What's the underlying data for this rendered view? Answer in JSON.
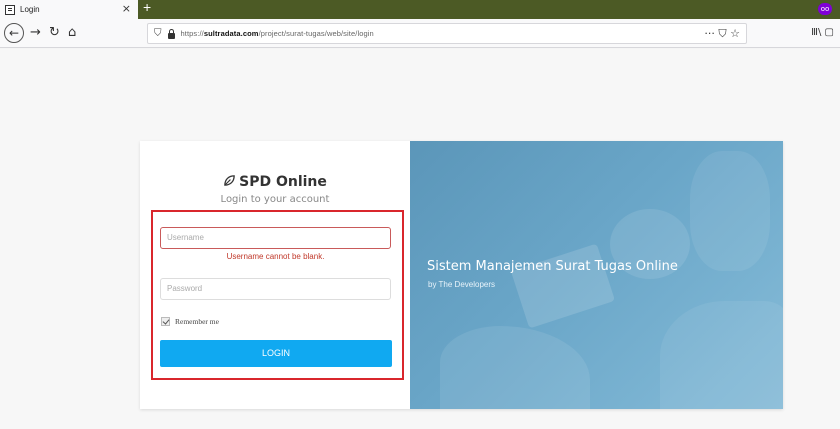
{
  "browser": {
    "tab_title": "Login",
    "tab_close": "×",
    "new_tab": "+",
    "mask_badge": "oo",
    "url_prefix": "https://",
    "url_domain": "sultradata.com",
    "url_path": "/project/surat-tugas/web/site/login",
    "url_actions": "··· ⛉ ☆",
    "right_tools": "Ⅲ\\ ▢"
  },
  "login": {
    "brand": "SPD Online",
    "subtitle": "Login to your account",
    "username_placeholder": "Username",
    "username_error": "Username cannot be blank.",
    "password_placeholder": "Password",
    "remember_label": "Remember me",
    "remember_checked": true,
    "login_label": "LOGIN"
  },
  "hero": {
    "title": "Sistem Manajemen Surat Tugas Online",
    "subtitle": "by The Developers"
  },
  "colors": {
    "accent": "#10a9f1",
    "error": "#c0392b",
    "highlight": "#d9262c",
    "hero": "#6aa6c8"
  }
}
